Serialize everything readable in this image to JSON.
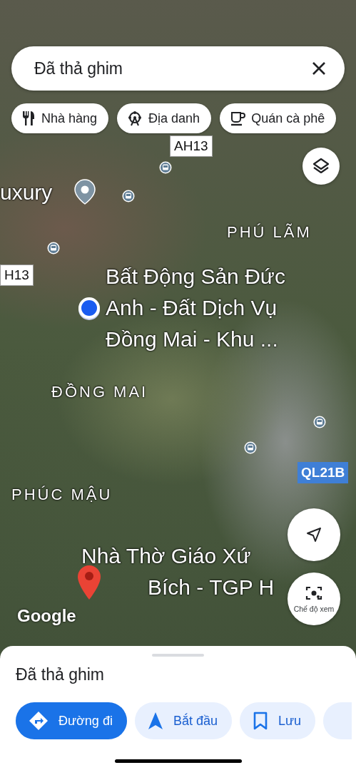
{
  "search_bar": {
    "text": "Đã thả ghim"
  },
  "chips": [
    {
      "label": "Nhà hàng",
      "kind": "restaurant"
    },
    {
      "label": "Địa danh",
      "kind": "landmark"
    },
    {
      "label": "Quán cà phê",
      "kind": "cafe"
    }
  ],
  "map": {
    "labels": [
      {
        "kind": "place",
        "lines": [
          "uxury"
        ]
      },
      {
        "kind": "route",
        "lines": [
          "AH13"
        ]
      },
      {
        "kind": "area",
        "lines": [
          "PHÚ LÃM"
        ]
      },
      {
        "kind": "route",
        "lines": [
          "H13"
        ]
      },
      {
        "kind": "place",
        "lines": [
          "Bất Động Sản Đức",
          "Anh - Đất Dịch Vụ",
          "Đồng Mai - Khu ..."
        ]
      },
      {
        "kind": "area",
        "lines": [
          "ĐỒNG MAI"
        ]
      },
      {
        "kind": "highway",
        "lines": [
          "QL21B"
        ]
      },
      {
        "kind": "area",
        "lines": [
          "PHÚC MẬU"
        ]
      },
      {
        "kind": "place",
        "lines": [
          "Nhà Thờ Giáo Xứ",
          "Bích - TGP H"
        ]
      }
    ],
    "attribution": "Google"
  },
  "view_mode_button": {
    "label": "Chế độ xem"
  },
  "sheet": {
    "title": "Đã thả ghim",
    "actions": [
      {
        "label": "Đường đi",
        "kind": "directions",
        "primary": true
      },
      {
        "label": "Bắt đầu",
        "kind": "start",
        "primary": false
      },
      {
        "label": "Lưu",
        "kind": "save",
        "primary": false
      }
    ]
  }
}
